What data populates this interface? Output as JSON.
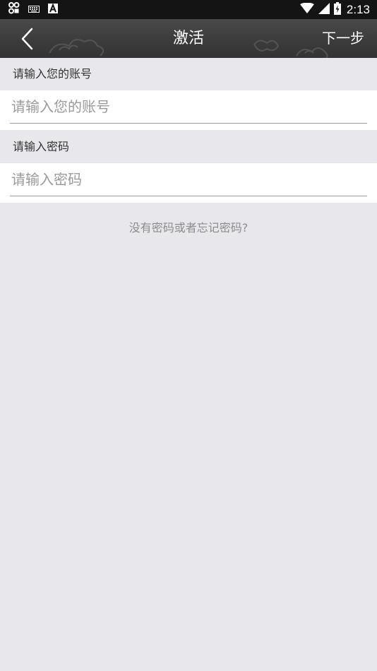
{
  "status_bar": {
    "time": "2:13",
    "left_icons": [
      "game-controller-icon",
      "keyboard-icon",
      "font-a-icon"
    ],
    "right_icons": [
      "wifi-icon",
      "cell-signal-icon",
      "battery-charging-icon"
    ]
  },
  "app_bar": {
    "title": "激活",
    "next_label": "下一步",
    "back_icon": "chevron-left-icon"
  },
  "account": {
    "label": "请输入您的账号",
    "placeholder": "请输入您的账号",
    "value": ""
  },
  "password": {
    "label": "请输入密码",
    "placeholder": "请输入密码",
    "value": ""
  },
  "forgot": {
    "label": "没有密码或者忘记密码?"
  },
  "colors": {
    "background": "#e8e7ec",
    "app_bar": "#3c3c3c",
    "status_bar": "#141414",
    "hint_text": "#9a9a9a"
  }
}
